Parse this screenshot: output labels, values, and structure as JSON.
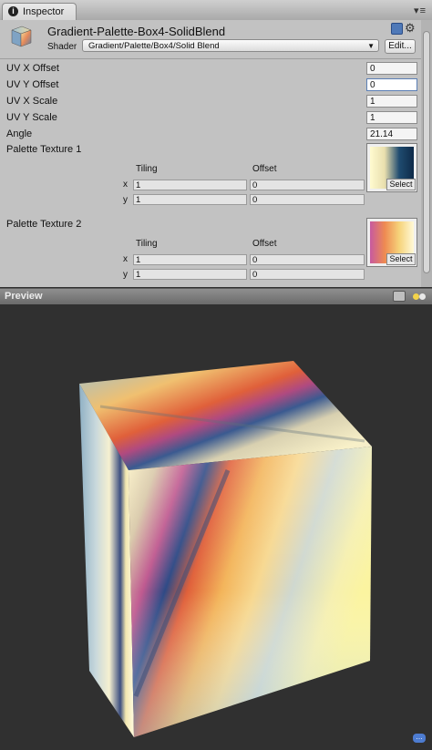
{
  "window": {
    "tab_label": "Inspector",
    "tab_icon": "info-icon",
    "menu_icon": "panel-menu-icon"
  },
  "material": {
    "name": "Gradient-Palette-Box4-SolidBlend",
    "icon": "material-cube-icon",
    "shader_label": "Shader",
    "shader_value": "Gradient/Palette/Box4/Solid Blend",
    "edit_label": "Edit...",
    "header_icons": [
      "help-book-icon",
      "gear-icon"
    ]
  },
  "properties": [
    {
      "label": "UV X Offset",
      "value": "0"
    },
    {
      "label": "UV Y Offset",
      "value": "0"
    },
    {
      "label": "UV X Scale",
      "value": "1"
    },
    {
      "label": "UV Y Scale",
      "value": "1"
    },
    {
      "label": "Angle",
      "value": "21.14"
    }
  ],
  "textures": [
    {
      "label": "Palette Texture 1",
      "tiling_header": "Tiling",
      "offset_header": "Offset",
      "x_label": "x",
      "y_label": "y",
      "tiling_x": "1",
      "tiling_y": "1",
      "offset_x": "0",
      "offset_y": "0",
      "select_label": "Select",
      "gradient_colors": [
        "#fffbd0",
        "#e9dfae",
        "#1f4b70",
        "#0e2a48"
      ]
    },
    {
      "label": "Palette Texture 2",
      "tiling_header": "Tiling",
      "offset_header": "Offset",
      "x_label": "x",
      "y_label": "y",
      "tiling_x": "1",
      "tiling_y": "1",
      "offset_x": "0",
      "offset_y": "0",
      "select_label": "Select",
      "gradient_colors": [
        "#c75aa0",
        "#ee8a52",
        "#f6d37a",
        "#fff9d8"
      ]
    }
  ],
  "preview": {
    "label": "Preview",
    "buttons": [
      "preview-mesh-icon",
      "preview-light-icon"
    ],
    "background": "#303030"
  }
}
